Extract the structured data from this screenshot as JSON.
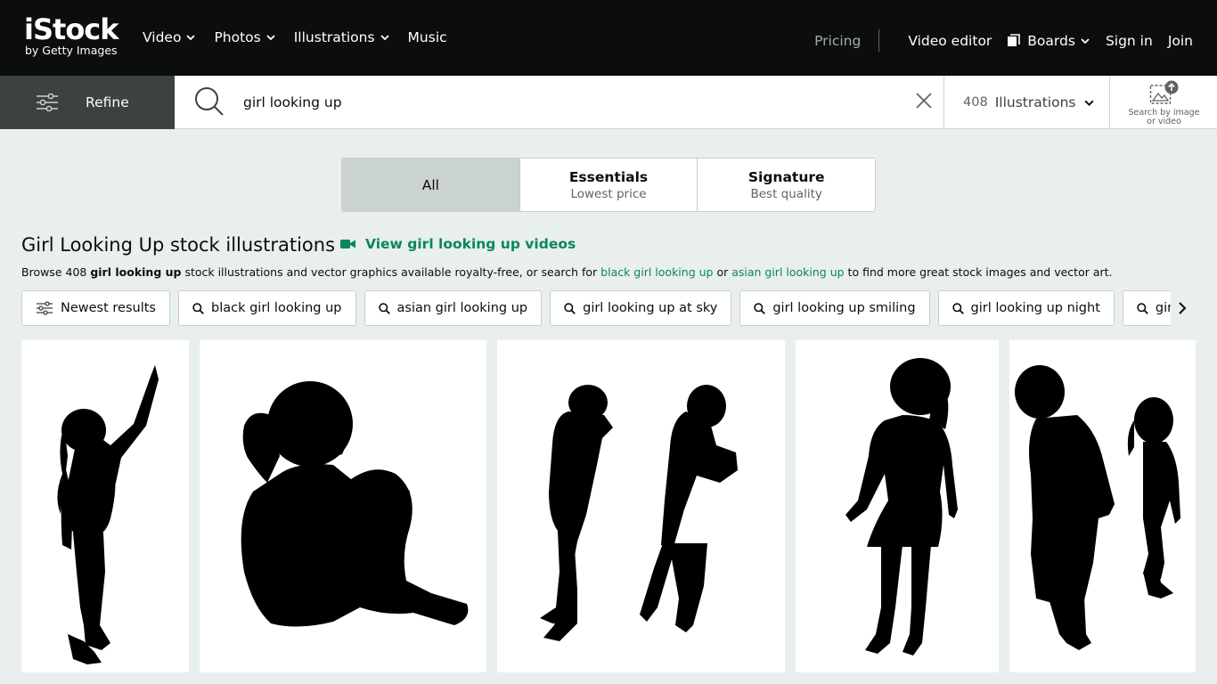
{
  "brand": {
    "name": "iStock",
    "tagline": "by Getty Images"
  },
  "nav": {
    "left": [
      {
        "label": "Video",
        "has_menu": true
      },
      {
        "label": "Photos",
        "has_menu": true
      },
      {
        "label": "Illustrations",
        "has_menu": true
      },
      {
        "label": "Music",
        "has_menu": false
      }
    ],
    "pricing": "Pricing",
    "video_editor": "Video editor",
    "boards": "Boards",
    "sign_in": "Sign in",
    "join": "Join"
  },
  "search": {
    "refine_label": "Refine",
    "query": "girl looking up",
    "result_count": "408",
    "asset_type": "Illustrations",
    "image_search_label_line1": "Search by image",
    "image_search_label_line2": "or video"
  },
  "segments": [
    {
      "label": "All",
      "sub": "",
      "active": true
    },
    {
      "label": "Essentials",
      "sub": "Lowest price",
      "active": false
    },
    {
      "label": "Signature",
      "sub": "Best quality",
      "active": false
    }
  ],
  "heading": {
    "title": "Girl Looking Up stock illustrations",
    "videos_link": "View girl looking up videos",
    "browse_prefix": "Browse 408 ",
    "browse_bold": "girl looking up",
    "browse_mid": " stock illustrations and vector graphics available royalty-free, or search for ",
    "browse_link1": "black girl looking up",
    "browse_or": " or ",
    "browse_link2": "asian girl looking up",
    "browse_suffix": " to find more great stock images and vector art."
  },
  "chips": [
    {
      "label": "Newest results",
      "icon": "sliders-icon"
    },
    {
      "label": "black girl looking up",
      "icon": "search-icon"
    },
    {
      "label": "asian girl looking up",
      "icon": "search-icon"
    },
    {
      "label": "girl looking up at sky",
      "icon": "search-icon"
    },
    {
      "label": "girl looking up smiling",
      "icon": "search-icon"
    },
    {
      "label": "girl looking up night",
      "icon": "search-icon"
    },
    {
      "label": "girl looking up",
      "icon": "search-icon"
    }
  ],
  "results": [
    {
      "subject": "girl pointing up silhouette"
    },
    {
      "subject": "girl sitting hugging knees silhouette"
    },
    {
      "subject": "two girls looking up silhouette"
    },
    {
      "subject": "girl in dress looking up silhouette"
    },
    {
      "subject": "boy and girl looking up silhouette"
    }
  ],
  "colors": {
    "topbar": "#0c0d0d",
    "refine_bg": "#3c4141",
    "page_bg": "#e9eeee",
    "accent_green": "#08875e",
    "active_segment": "#cbd2d2"
  }
}
